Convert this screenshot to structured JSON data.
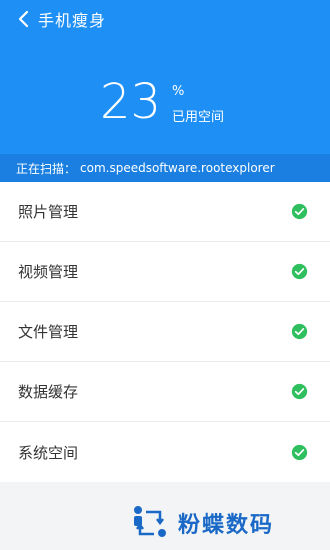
{
  "header": {
    "title": "手机瘦身",
    "percent_value": "23",
    "percent_symbol": "%",
    "percent_label": "已用空间",
    "scan_prefix": "正在扫描：",
    "scan_target": "com.speedsoftware.rootexplorer",
    "colors": {
      "header_bg": "#1e8ff5",
      "scan_bg": "#1a7fe0"
    }
  },
  "items": [
    {
      "label": "照片管理",
      "status_icon": "check-circle-icon"
    },
    {
      "label": "视频管理",
      "status_icon": "check-circle-icon"
    },
    {
      "label": "文件管理",
      "status_icon": "check-circle-icon"
    },
    {
      "label": "数据缓存",
      "status_icon": "check-circle-icon"
    },
    {
      "label": "系统空间",
      "status_icon": "check-circle-icon"
    }
  ],
  "watermark": {
    "text": "粉蝶数码"
  },
  "status_color": "#2fbf5f"
}
